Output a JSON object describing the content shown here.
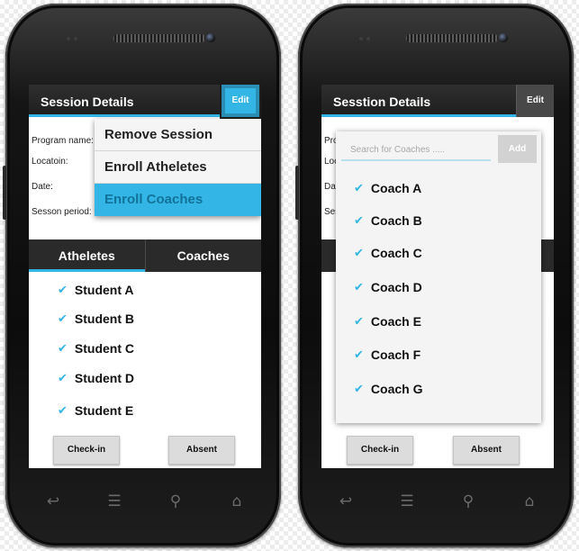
{
  "left_screen": {
    "title": "Session Details",
    "edit_label": "Edit",
    "fields": [
      "Program name:",
      "Locatoin:",
      "Date:",
      "Sesson period:"
    ],
    "menu": [
      {
        "label": "Remove Session"
      },
      {
        "label": "Enroll Atheletes"
      },
      {
        "label": "Enroll Coaches",
        "selected": true
      }
    ],
    "tabs": [
      {
        "label": "Atheletes",
        "active": true
      },
      {
        "label": "Coaches",
        "active": false
      }
    ],
    "students": [
      "Student A",
      "Student B",
      "Student C",
      "Student D",
      "Student E"
    ],
    "checkin_label": "Check-in",
    "absent_label": "Absent"
  },
  "right_screen": {
    "title": "Sesstion Details",
    "edit_label": "Edit",
    "fields_partial": [
      "Pro",
      "Loc",
      "Dat",
      "Ses"
    ],
    "search": {
      "placeholder": "Search for Coaches ....."
    },
    "add_label": "Add",
    "coaches": [
      "Coach A",
      "Coach B",
      "Coach C",
      "Coach D",
      "Coach E",
      "Coach F",
      "Coach G"
    ],
    "checkin_label": "Check-in",
    "absent_label": "Absent"
  },
  "icons": {
    "check": "checkmark-icon",
    "nav": [
      "back-icon",
      "menu-icon",
      "search-icon",
      "home-icon"
    ]
  },
  "colors": {
    "accent": "#33b5e5",
    "titlebar": "#262626",
    "tabs": "#2a2a2a"
  }
}
